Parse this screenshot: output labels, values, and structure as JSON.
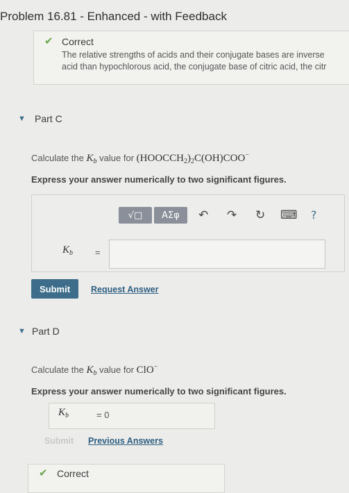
{
  "header": {
    "title": "Problem 16.81 - Enhanced - with Feedback"
  },
  "feedback": {
    "status": "Correct",
    "line1": "The relative strengths of acids and their conjugate bases are inverse",
    "line2": "acid than hypochlorous acid, the conjugate base of citric acid, the citr"
  },
  "part_c": {
    "label": "Part C",
    "question_prefix": "Calculate the",
    "question_mid": "value for",
    "formula": {
      "main": "(HOOCCH",
      "sub": "2",
      "close": ")",
      "sub2": "2",
      "tail": "C(OH)COO",
      "charge": "−"
    },
    "kb_symbol": "K",
    "kb_sub": "b",
    "instruction": "Express your answer numerically to two significant figures.",
    "toolbar": {
      "template_label": "√□",
      "greek_label": "ΑΣφ",
      "undo_icon": "↶",
      "redo_icon": "↷",
      "reset_icon": "↻",
      "keyboard_icon": "⌨",
      "help_label": "?"
    },
    "equals": "=",
    "answer_value": "",
    "submit_label": "Submit",
    "request_label": "Request Answer"
  },
  "part_d": {
    "label": "Part D",
    "question_prefix": "Calculate the",
    "question_mid": "value for",
    "formula": "ClO",
    "charge": "−",
    "instruction": "Express your answer numerically to two significant figures.",
    "answer_text": "= 0",
    "submit_label": "Submit",
    "previous_label": "Previous Answers",
    "status": "Correct"
  }
}
